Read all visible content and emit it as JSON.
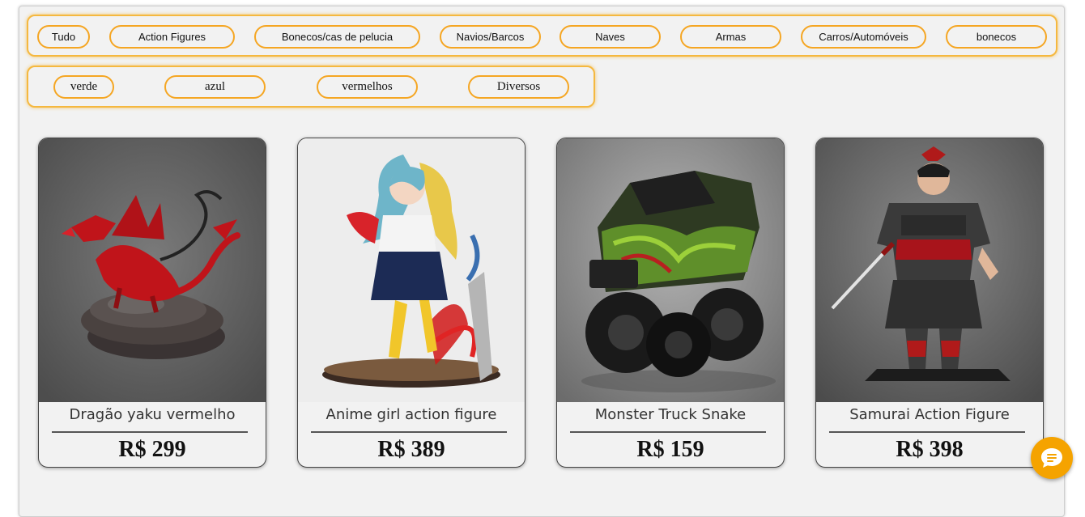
{
  "top_mark": "--",
  "categories": [
    "Tudo",
    "Action Figures",
    "Bonecos/cas de pelucia",
    "Navios/Barcos",
    "Naves",
    "Armas",
    "Carros/Automóveis",
    "bonecos"
  ],
  "colors_filters": [
    "verde",
    "azul",
    "vermelhos",
    "Diversos"
  ],
  "products": [
    {
      "name": "Dragão yaku vermelho",
      "price": "R$ 299",
      "image": "red-dragon-figure"
    },
    {
      "name": "Anime girl action figure",
      "price": "R$ 389",
      "image": "anime-girl-figure"
    },
    {
      "name": "Monster Truck Snake",
      "price": "R$ 159",
      "image": "monster-truck-toy"
    },
    {
      "name": "Samurai Action Figure",
      "price": "R$ 398",
      "image": "samurai-figure"
    }
  ],
  "chat_button": {
    "icon": "chat-bubble-icon"
  },
  "theme": {
    "accent": "#f5a623",
    "background": "#f2f2f2"
  }
}
